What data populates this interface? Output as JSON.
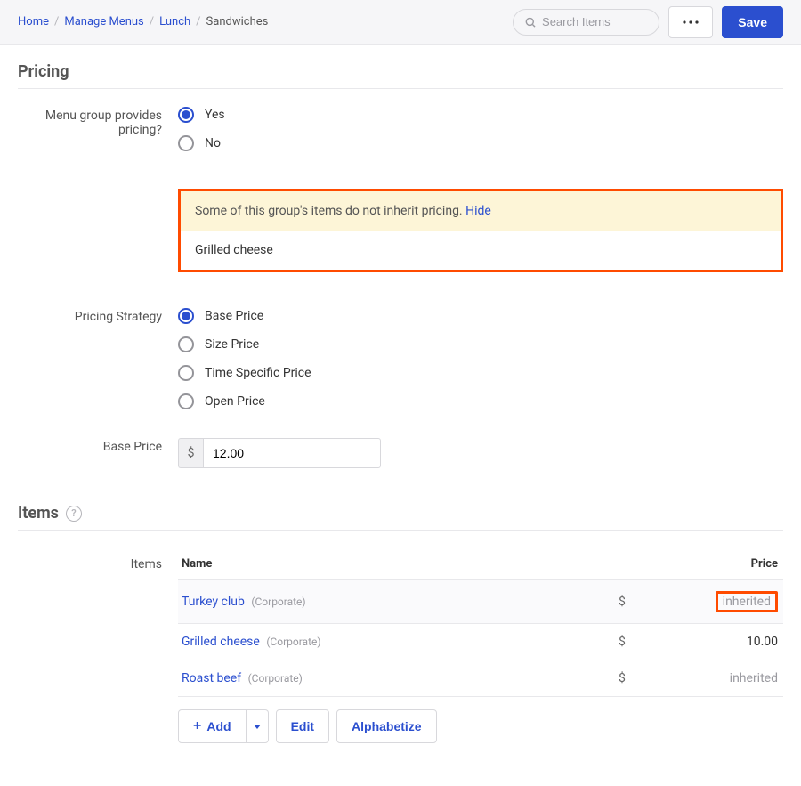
{
  "breadcrumbs": [
    {
      "label": "Home",
      "link": true
    },
    {
      "label": "Manage Menus",
      "link": true
    },
    {
      "label": "Lunch",
      "link": true
    },
    {
      "label": "Sandwiches",
      "link": false
    }
  ],
  "search_placeholder": "Search Items",
  "save_label": "Save",
  "sections": {
    "pricing_title": "Pricing",
    "items_title": "Items"
  },
  "pricing": {
    "group_pricing_label": "Menu group provides pricing?",
    "yes_label": "Yes",
    "no_label": "No",
    "notice_text": "Some of this group's items do not inherit pricing. ",
    "notice_hide": "Hide",
    "notice_items": [
      "Grilled cheese"
    ],
    "strategy_label": "Pricing Strategy",
    "strategies": [
      "Base Price",
      "Size Price",
      "Time Specific Price",
      "Open Price"
    ],
    "base_price_label": "Base Price",
    "currency": "$",
    "base_price_value": "12.00"
  },
  "items": {
    "label": "Items",
    "columns": {
      "name": "Name",
      "price": "Price"
    },
    "rows": [
      {
        "name": "Turkey club",
        "tag": "(Corporate)",
        "price": "inherited",
        "inherited": true,
        "highlight": true,
        "active": true
      },
      {
        "name": "Grilled cheese",
        "tag": "(Corporate)",
        "price": "10.00",
        "inherited": false,
        "highlight": false,
        "active": false
      },
      {
        "name": "Roast beef",
        "tag": "(Corporate)",
        "price": "inherited",
        "inherited": true,
        "highlight": false,
        "active": false
      }
    ],
    "actions": {
      "add": "Add",
      "edit": "Edit",
      "alpha": "Alphabetize"
    }
  }
}
